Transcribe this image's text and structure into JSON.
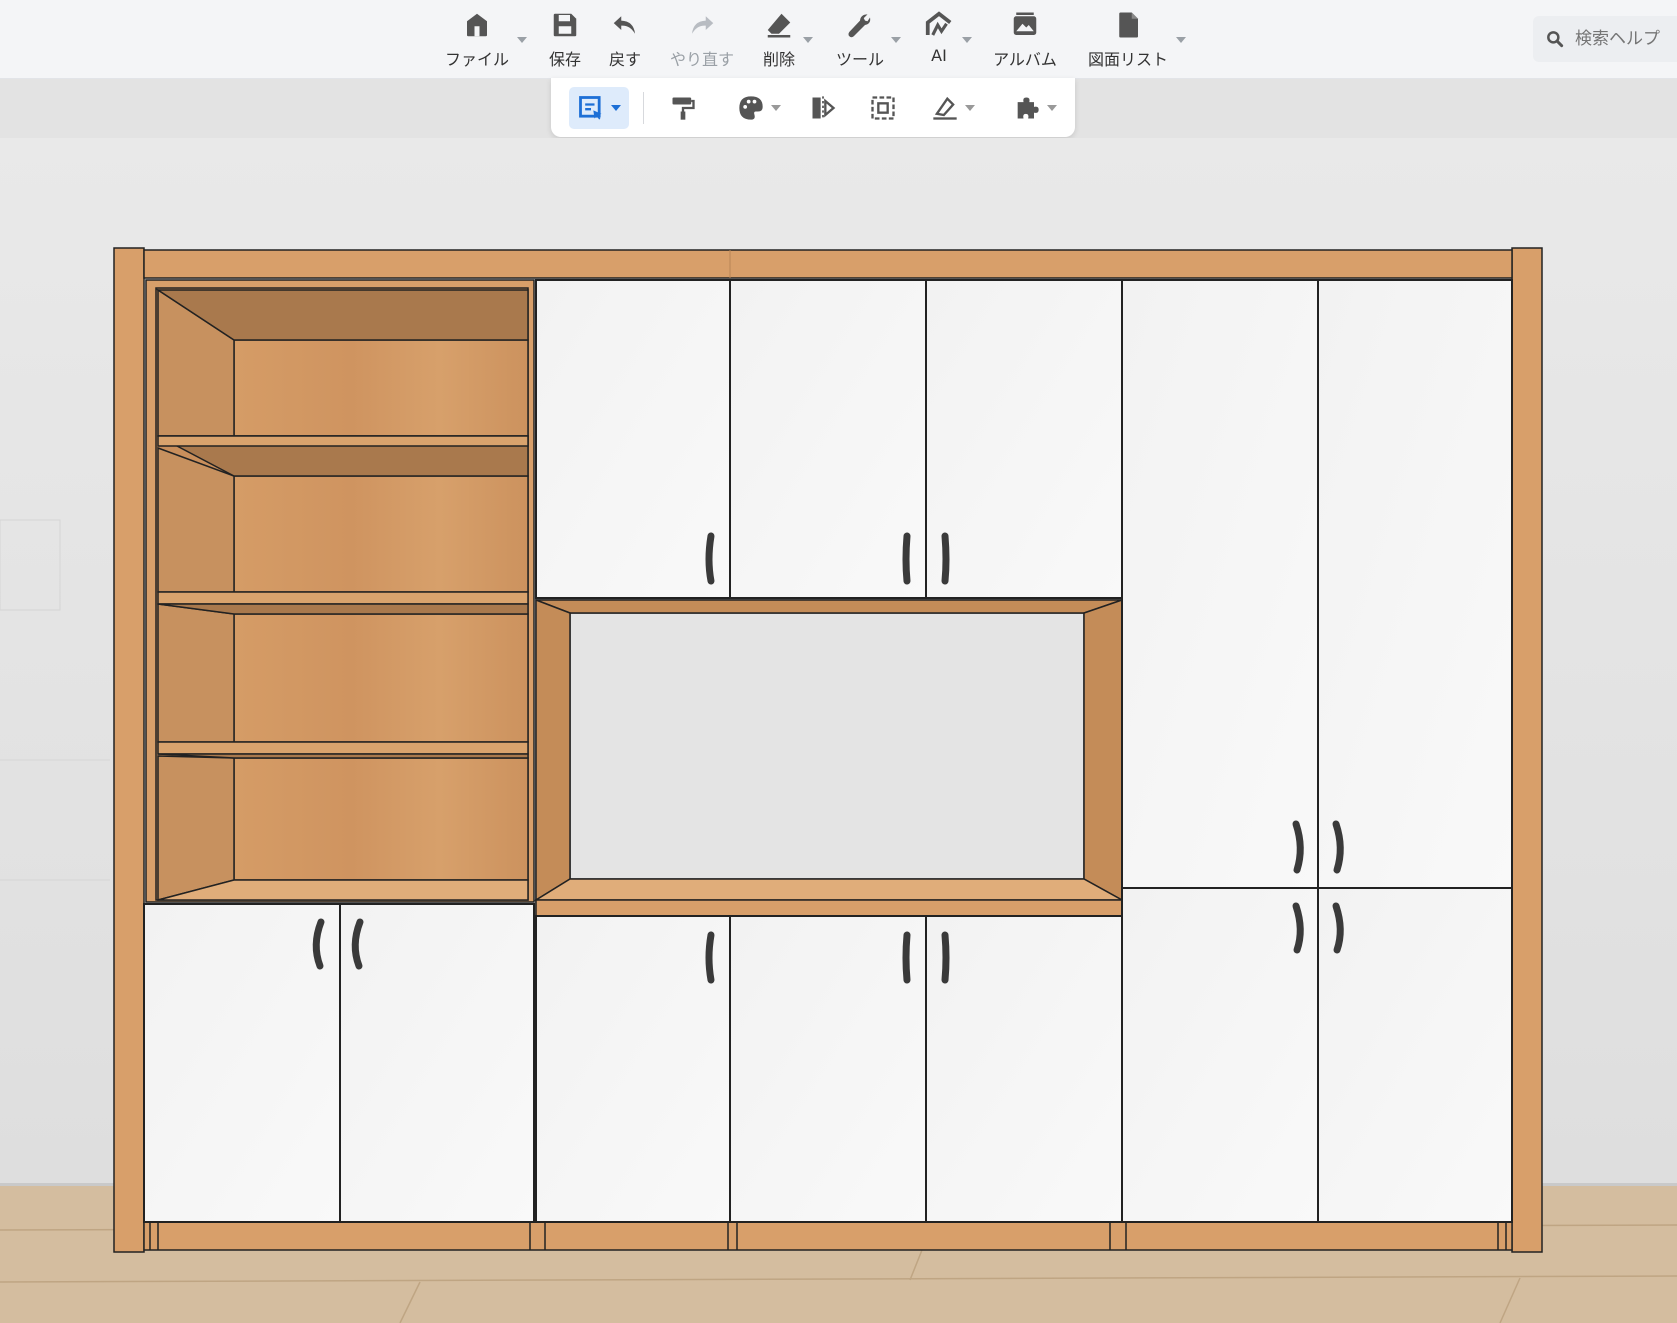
{
  "toolbar": {
    "items": [
      {
        "label": "ファイル",
        "icon": "home-icon"
      },
      {
        "label": "保存",
        "icon": "save-icon"
      },
      {
        "label": "戻す",
        "icon": "undo-icon"
      },
      {
        "label": "やり直す",
        "icon": "redo-icon",
        "disabled": true
      },
      {
        "label": "削除",
        "icon": "eraser-icon"
      },
      {
        "label": "ツール",
        "icon": "wrench-icon"
      },
      {
        "label": "AI",
        "icon": "ai-icon"
      },
      {
        "label": "アルバム",
        "icon": "album-icon"
      },
      {
        "label": "図面リスト",
        "icon": "drawing-list-icon"
      }
    ]
  },
  "search": {
    "placeholder": "検索ヘルプ"
  },
  "subtoolbar": {
    "tools": [
      "select-mode-icon",
      "paint-roller-icon",
      "palette-icon",
      "mirror-icon",
      "frame-select-icon",
      "measure-icon",
      "plugin-icon"
    ],
    "active": "select-mode-icon"
  },
  "colors": {
    "wood": "#d89f6a",
    "wood_dark": "#b27b4b",
    "door_white": "#f3f3f3",
    "accent": "#3a8ee6",
    "wall": "#e3e3e3",
    "floor": "#d4bd9f"
  }
}
